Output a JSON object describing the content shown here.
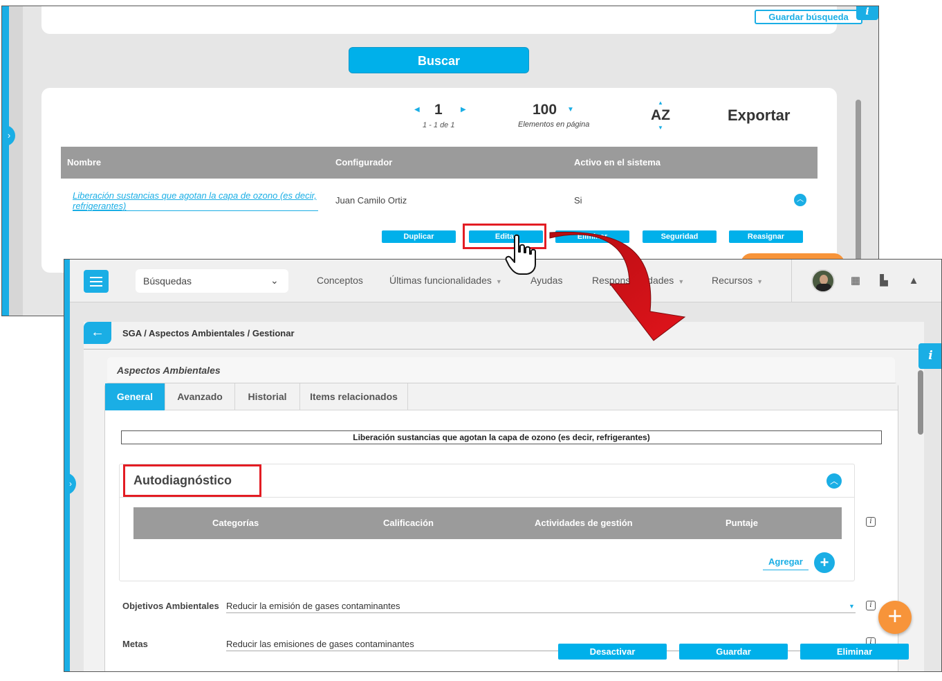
{
  "back": {
    "save_search_label": "Guardar búsqueda",
    "info_label": "i",
    "search_button": "Buscar",
    "pager": {
      "page": "1",
      "range": "1 - 1 de 1",
      "per_page": "100",
      "per_page_label": "Elementos en página",
      "sort_label": "AZ",
      "export_label": "Exportar"
    },
    "table": {
      "columns": [
        "Nombre",
        "Configurador",
        "Activo en el sistema"
      ],
      "row": {
        "name": "Liberación sustancias que agotan la capa de ozono (es decir, refrigerantes)",
        "configurator": "Juan Camilo Ortiz",
        "active": "Si"
      },
      "actions": [
        "Duplicar",
        "Editar",
        "Eliminar",
        "Seguridad",
        "Reasignar"
      ]
    }
  },
  "front": {
    "topbar": {
      "search_select": "Búsquedas",
      "nav": [
        {
          "label": "Conceptos",
          "caret": false
        },
        {
          "label": "Últimas funcionalidades",
          "caret": true
        },
        {
          "label": "Ayudas",
          "caret": false
        },
        {
          "label": "Responsabilidades",
          "caret": true
        },
        {
          "label": "Recursos",
          "caret": true
        }
      ]
    },
    "breadcrumb": "SGA / Aspectos Ambientales / Gestionar",
    "info_label": "i",
    "section_title": "Aspectos Ambientales",
    "tabs": [
      "General",
      "Avanzado",
      "Historial",
      "Items relacionados"
    ],
    "active_tab": "General",
    "record_title": "Liberación sustancias que agotan la capa de ozono (es decir, refrigerantes)",
    "autodiagnostico": {
      "title": "Autodiagnóstico",
      "columns": [
        "Categorías",
        "Calificación",
        "Actividades de gestión",
        "Puntaje"
      ],
      "add_label": "Agregar"
    },
    "fields": [
      {
        "label": "Objetivos Ambientales",
        "value": "Reducir la emisión de gases contaminantes"
      },
      {
        "label": "Metas",
        "value": "Reducir las emisiones de gases contaminantes"
      }
    ],
    "buttons": [
      "Desactivar",
      "Guardar",
      "Eliminar"
    ]
  },
  "colors": {
    "accent": "#1aaee5",
    "highlight": "#e31c23",
    "fab": "#f7943a",
    "table_header": "#9b9b9b"
  },
  "icons": [
    "chevron-right-icon",
    "menu-icon",
    "chevron-down-icon",
    "calendar-icon",
    "map-icon",
    "bell-icon",
    "back-arrow-icon",
    "info-icon",
    "plus-icon",
    "hand-cursor-icon",
    "curved-arrow-icon"
  ]
}
